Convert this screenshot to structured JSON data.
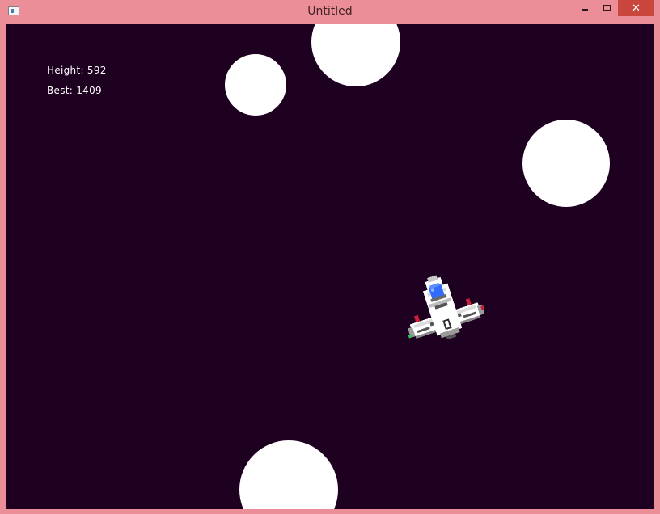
{
  "window": {
    "title": "Untitled",
    "close_glyph": "✕"
  },
  "hud": {
    "height_label": "Height: 592",
    "best_label": "Best: 1409"
  },
  "colors": {
    "titlebar": "#ec8e98",
    "close_button": "#c9463d",
    "space_background": "#1e0020",
    "asteroid": "#ffffff",
    "hud_text": "#ffffff",
    "ship_cockpit": "#2f6bff"
  },
  "icons": {
    "app": "app-window-icon",
    "minimize": "minimize-icon",
    "maximize": "maximize-icon",
    "close": "close-icon",
    "player": "spaceship-sprite"
  }
}
